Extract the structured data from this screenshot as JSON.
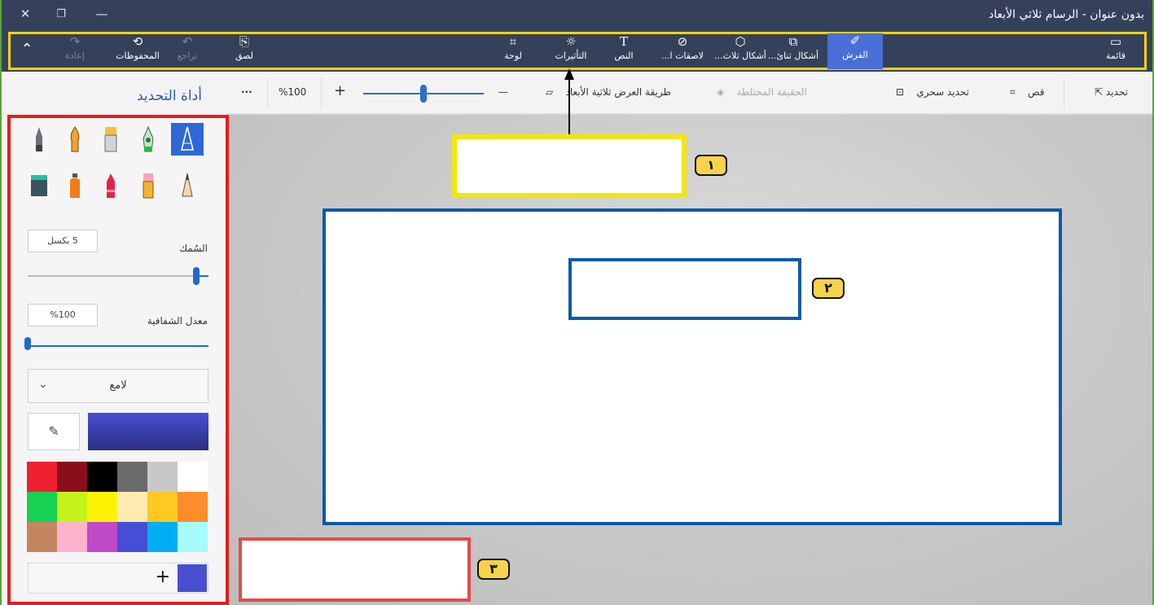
{
  "window": {
    "title": "بدون عنوان - الرسام ثلاثي الأبعاد",
    "close_glyph": "✕",
    "restore_glyph": "❐",
    "minimize_glyph": "—"
  },
  "ribbon": {
    "menu_label": "قائمة",
    "brushes_label": "الفرش",
    "shapes2d_label": "أشكال ثنائ...",
    "shapes3d_label": "أشكال ثلاث...",
    "stickers_label": "لاصقات ا...",
    "text_label": "النص",
    "effects_label": "التأثيرات",
    "canvas_label": "لوحة",
    "paste_label": "لصق",
    "undo_label": "تراجع",
    "history_label": "المحفوظات",
    "redo_label": "إعادة"
  },
  "toolbar": {
    "select_label": "تحديد",
    "crop_label": "قص",
    "magic_select_label": "تحديد سحري",
    "mixed_reality_label": "الحقيقة المختلطة",
    "view_3d_label": "طريقة العرض ثلاثية الأبعاد",
    "zoom_minus": "—",
    "zoom_plus": "+",
    "zoom_value": "%100",
    "zoom_fraction": 0.5,
    "more_label": "···"
  },
  "panel": {
    "title": "أداة التحديد",
    "thickness_label": "السُمك",
    "thickness_value": "5 بكسل",
    "thickness_fraction": 0.05,
    "opacity_label": "معدل الشفافية",
    "opacity_value": "%100",
    "opacity_fraction": 1.0,
    "finish_value": "لامع",
    "add_color": "+",
    "current_color": "#4a4fd0",
    "palette": [
      "#ffffff",
      "#c8c8c8",
      "#6a6a6a",
      "#000000",
      "#8a0f1d",
      "#ee2030",
      "#ff8c2a",
      "#ffc823",
      "#ffeab0",
      "#fff200",
      "#c3f318",
      "#17d153",
      "#a6fbfb",
      "#00aef3",
      "#474fd6",
      "#be4ac7",
      "#ffb3cd",
      "#c48661"
    ]
  },
  "annotations": {
    "badge1": "١",
    "badge2": "٢",
    "badge3": "٣",
    "color_yellow": "#f4e60c",
    "color_blue": "#0b5aa8",
    "color_red": "#e34b4b"
  }
}
